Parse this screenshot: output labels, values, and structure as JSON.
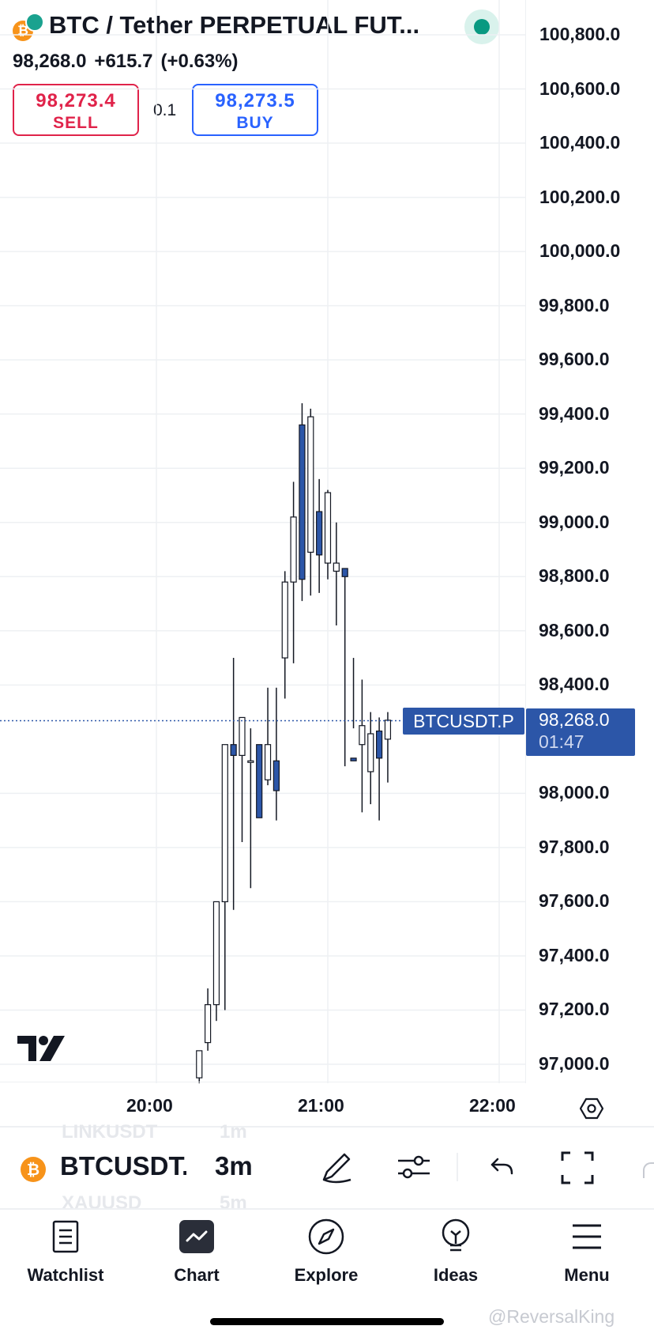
{
  "header": {
    "title": "BTC / Tether PERPETUAL FUT...",
    "last_price": "98,268.0",
    "change": "+615.7",
    "change_pct": "(+0.63%)",
    "sell_price": "98,273.4",
    "sell_label": "SELL",
    "buy_price": "98,273.5",
    "buy_label": "BUY",
    "quantity": "0.1",
    "coin_glyph": "₿"
  },
  "chart": {
    "y_ticks": [
      "100,800.0",
      "100,600.0",
      "100,400.0",
      "100,200.0",
      "100,000.0",
      "99,800.0",
      "99,600.0",
      "99,400.0",
      "99,200.0",
      "99,000.0",
      "98,800.0",
      "98,600.0",
      "98,400.0",
      "98,000.0",
      "97,800.0",
      "97,600.0",
      "97,400.0",
      "97,200.0",
      "97,000.0"
    ],
    "x_ticks": [
      "20:00",
      "21:00",
      "22:00"
    ],
    "symbol_tag": "BTCUSDT.P",
    "price_tag": "98,268.0",
    "countdown": "01:47",
    "colors": {
      "up": "#ffffff",
      "down": "#2c56a8",
      "wick": "#131722",
      "price_line": "#2c56a8"
    }
  },
  "toolbar": {
    "symbol": "BTCUSDT.P",
    "timeframe": "3m",
    "ghost_prev_symbol": "LINKUSDT",
    "ghost_prev_tf": "1m",
    "ghost_next_symbol": "XAUUSD",
    "ghost_next_tf": "5m",
    "icons": [
      "pen-icon",
      "sliders-icon",
      "undo-icon",
      "fullscreen-icon"
    ]
  },
  "nav": [
    {
      "label": "Watchlist",
      "icon": "watchlist-icon"
    },
    {
      "label": "Chart",
      "icon": "chart-icon"
    },
    {
      "label": "Explore",
      "icon": "compass-icon"
    },
    {
      "label": "Ideas",
      "icon": "lightbulb-icon"
    },
    {
      "label": "Menu",
      "icon": "hamburger-icon"
    }
  ],
  "watermark": "@ReversalKing",
  "chart_data": {
    "type": "candlestick",
    "x": [
      "20:15",
      "20:18",
      "20:21",
      "20:24",
      "20:27",
      "20:30",
      "20:33",
      "20:36",
      "20:39",
      "20:42",
      "20:45",
      "20:48",
      "20:51",
      "20:54",
      "20:57",
      "21:00",
      "21:03",
      "21:06",
      "21:09",
      "21:12",
      "21:15",
      "21:18",
      "21:21"
    ],
    "open": [
      96950,
      97080,
      97220,
      97600,
      98180,
      98140,
      98120,
      98180,
      98050,
      98120,
      98500,
      98780,
      99360,
      98890,
      99040,
      98850,
      98820,
      98830,
      98130,
      98180,
      98080,
      98230,
      98200
    ],
    "high": [
      97050,
      97280,
      97300,
      97620,
      98500,
      98200,
      98240,
      98170,
      98390,
      98390,
      98820,
      99150,
      99440,
      99420,
      99160,
      99120,
      99000,
      98830,
      98500,
      98420,
      98300,
      98280,
      98300
    ],
    "low": [
      96900,
      97050,
      97160,
      97200,
      97570,
      97820,
      97650,
      97980,
      98030,
      97900,
      98350,
      98480,
      98710,
      98730,
      98740,
      98790,
      98620,
      98100,
      98240,
      97930,
      97960,
      97900,
      98040
    ],
    "close": [
      97050,
      97220,
      97600,
      98180,
      98140,
      98280,
      98120,
      97910,
      98180,
      98010,
      98780,
      99020,
      98790,
      99390,
      98880,
      99110,
      98850,
      98800,
      98120,
      98250,
      98220,
      98130,
      98270
    ],
    "ylim": [
      96930,
      100870
    ]
  }
}
